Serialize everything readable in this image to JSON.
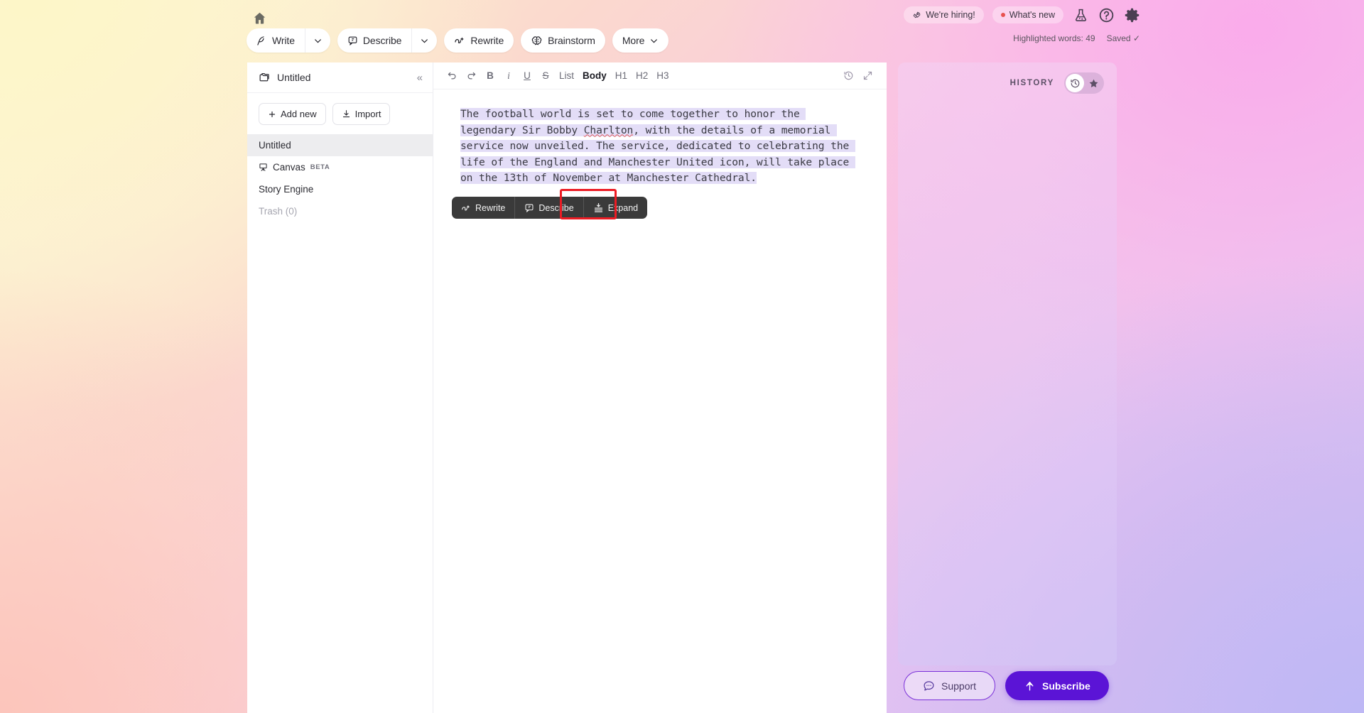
{
  "header": {
    "home_icon": "home-icon",
    "tools": [
      {
        "label": "Write",
        "icon": "feather-pen-icon",
        "has_caret": true
      },
      {
        "label": "Describe",
        "icon": "comment-box-icon",
        "has_caret": true
      },
      {
        "label": "Rewrite",
        "icon": "ai-swirl-icon",
        "has_caret": false
      },
      {
        "label": "Brainstorm",
        "icon": "brain-icon",
        "has_caret": false
      },
      {
        "label": "More",
        "icon": "",
        "has_caret": true
      }
    ],
    "hiring_label": "We're hiring!",
    "hiring_icon": "rocket-icon",
    "whats_new_label": "What's new",
    "icons": [
      {
        "name": "lab-flask-icon"
      },
      {
        "name": "help-circle-icon"
      },
      {
        "name": "gear-icon"
      }
    ],
    "highlighted_words": "Highlighted words: 49",
    "saved_label": "Saved",
    "saved_check": "✓"
  },
  "sidebar": {
    "title": "Untitled",
    "folder_icon": "folder-icon",
    "collapse_icon": "chevron-double-left-icon",
    "add_new_label": "Add new",
    "import_label": "Import",
    "items": [
      {
        "label": "Untitled",
        "state": "active",
        "icon": "",
        "badge": ""
      },
      {
        "label": "Canvas",
        "state": "normal",
        "icon": "easel-icon",
        "badge": "BETA"
      },
      {
        "label": "Story Engine",
        "state": "normal",
        "icon": "",
        "badge": ""
      },
      {
        "label": "Trash (0)",
        "state": "muted",
        "icon": "",
        "badge": ""
      }
    ]
  },
  "editor": {
    "toolbar": {
      "undo": "undo-icon",
      "redo": "redo-icon",
      "bold": "B",
      "italic": "i",
      "underline": "U",
      "strike": "S",
      "list": "List",
      "body": "Body",
      "h1": "H1",
      "h2": "H2",
      "h3": "H3",
      "history_icon": "clock-history-icon",
      "expand_icon": "expand-diagonal-icon",
      "active_style": "Body"
    },
    "document": {
      "text_part_1": "The football world is set to come together to honor the legendary Sir Bobby ",
      "misspelled_word": "Charlton",
      "text_part_2": ", with the details of a memorial service now unveiled. The service, dedicated to celebrating the life of the England and Manchester United icon, will take place on the 13th of November at Manchester Cathedral.",
      "highlight_color": "#e3ddf7",
      "spellcheck_underline_color": "#e05a5a"
    },
    "context_toolbar": {
      "items": [
        {
          "label": "Rewrite",
          "icon": "ai-swirl-icon",
          "highlighted": false
        },
        {
          "label": "Describe",
          "icon": "comment-box-icon",
          "highlighted": false
        },
        {
          "label": "Expand",
          "icon": "expand-lines-icon",
          "highlighted": true
        }
      ],
      "highlight_box_color": "#ec1c24"
    }
  },
  "history_panel": {
    "title": "HISTORY",
    "toggle": [
      {
        "name": "clock-history-icon",
        "selected": true
      },
      {
        "name": "star-icon",
        "selected": false
      }
    ]
  },
  "footer": {
    "support_label": "Support",
    "support_icon": "chat-bubble-icon",
    "subscribe_label": "Subscribe",
    "subscribe_icon": "up-arrow-icon",
    "subscribe_color": "#5b14d6"
  }
}
